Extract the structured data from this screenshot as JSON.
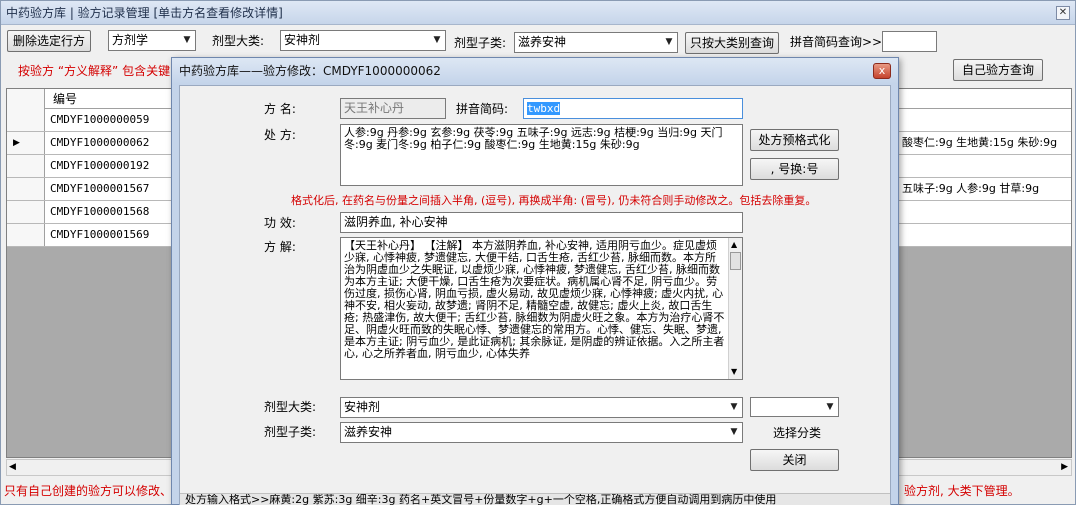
{
  "main": {
    "title": "中药验方库 | 验方记录管理 [单击方名查看修改详情]",
    "close_glyph": "✕",
    "toolbar": {
      "delete_button": "删除选定行方",
      "category_select": "方剂学",
      "major_label": "剂型大类:",
      "major_select": "安神剂",
      "minor_label": "剂型子类:",
      "minor_select": "滋养安神",
      "query_major_button": "只按大类别查询",
      "pinyin_label": "拼音简码查询>>",
      "pinyin_value": ""
    },
    "hint_top": "按验方 “方义解释” 包含关键",
    "my_query_button": "自己验方查询",
    "grid": {
      "column_header": "编号",
      "current_row_marker": "▶",
      "rows": [
        {
          "id": "CMDYF1000000059",
          "rest": ""
        },
        {
          "id": "CMDYF1000000062",
          "rest": "酸枣仁:9g 生地黄:15g 朱砂:9g"
        },
        {
          "id": "CMDYF1000000192",
          "rest": ""
        },
        {
          "id": "CMDYF1000001567",
          "rest": "五味子:9g 人参:9g 甘草:9g"
        },
        {
          "id": "CMDYF1000001568",
          "rest": ""
        },
        {
          "id": "CMDYF1000001569",
          "rest": ""
        }
      ]
    },
    "bottom_left_note": "只有自己创建的验方可以修改、",
    "bottom_right_note": "验方剂, 大类下管理。"
  },
  "dialog": {
    "title": "中药验方库——验方修改：CMDYF1000000062",
    "close_glyph": "x",
    "name_label": "方    名:",
    "name_value": "天王补心丹",
    "pinyin_label": "拼音简码:",
    "pinyin_value": "twbxd",
    "prescription_label": "处    方:",
    "prescription_value": "人参:9g 丹参:9g 玄参:9g 茯苓:9g 五味子:9g 远志:9g 桔梗:9g 当归:9g 天门冬:9g 麦门冬:9g 柏子仁:9g 酸枣仁:9g 生地黄:15g 朱砂:9g",
    "format_button": "处方预格式化",
    "replace_button": ", 号换:号",
    "format_note": "格式化后, 在药名与份量之间插入半角, (逗号), 再换成半角: (冒号), 仍未符合则手动修改之。包括去除重复。",
    "effect_label": "功    效:",
    "effect_value": "滋阴养血, 补心安神",
    "explain_label": "方    解:",
    "explain_value": "【天王补心丹】 【注解】 本方滋阴养血, 补心安神, 适用阴亏血少。症见虚烦少寐, 心悸神疲, 梦遗健忘, 大便干结, 口舌生疮, 舌红少苔, 脉细而数。本方所治为阴虚血少之失眠证, 以虚烦少寐, 心悸神疲, 梦遗健忘, 舌红少苔, 脉细而数为本方主证; 大便干燥, 口舌生疮为次要症状。病机属心肾不足, 阴亏血少。劳伤过度, 损伤心肾, 阴血亏损, 虚火易动, 故见虚烦少寐, 心悸神疲; 虚火内扰, 心神不安, 相火妄动, 故梦遗; 肾阴不足, 精髓空虚, 故健忘; 虚火上炎, 故口舌生疮; 热盛津伤, 故大便干; 舌红少苔, 脉细数为阴虚火旺之象。本方为治疗心肾不足、阴虚火旺而致的失眠心悸、梦遗健忘的常用方。心悸、健忘、失眠、梦遗, 是本方主证; 阴亏血少, 是此证病机; 其余脉证, 是阴虚的辨证依据。入之所主者心, 心之所养者血, 阴亏血少, 心体失养",
    "major_label": "剂型大类:",
    "major_value": "安神剂",
    "minor_label": "剂型子类:",
    "minor_value": "滋养安神",
    "extra_select_value": "",
    "choose_label": "选择分类",
    "close_button": "关闭",
    "status_text": "处方输入格式>>麻黄:2g 紫苏:3g 细辛:3g 药名+英文冒号+份量数字+g+一个空格,正确格式方便自动调用到病历中使用"
  },
  "icons": {
    "dropdown": "▼",
    "scroll_up": "▲",
    "scroll_down": "▼",
    "scroll_left": "◀",
    "scroll_right": "▶"
  },
  "colors": {
    "warning_red": "#d40000",
    "title_blue": "#c4d4ea",
    "selection_blue": "#3399ff"
  }
}
